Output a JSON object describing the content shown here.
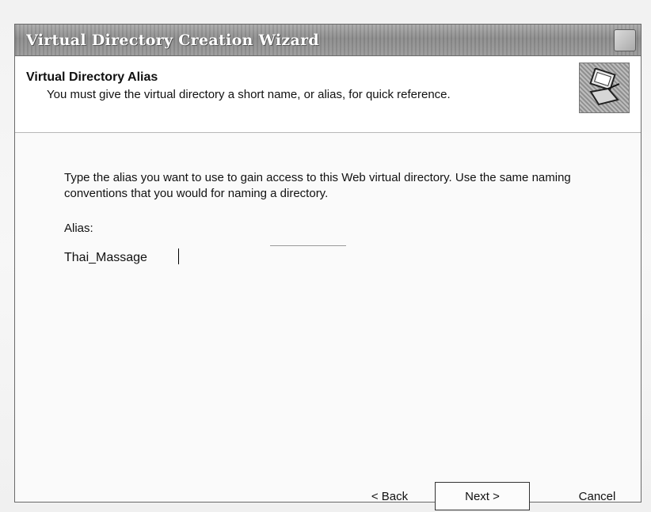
{
  "window": {
    "title": "Virtual Directory Creation Wizard"
  },
  "header": {
    "title": "Virtual Directory Alias",
    "subtitle": "You must give the virtual directory a short name, or alias, for quick reference."
  },
  "main": {
    "instructions": "Type the alias you want to use to gain access to this Web virtual directory. Use the same naming conventions that you would for naming a directory.",
    "alias_label": "Alias:",
    "alias_value": "Thai_Massage"
  },
  "buttons": {
    "back": "< Back",
    "next": "Next >",
    "cancel": "Cancel"
  },
  "icons": {
    "header_icon": "wizard-computer-icon",
    "close": "close-icon"
  }
}
